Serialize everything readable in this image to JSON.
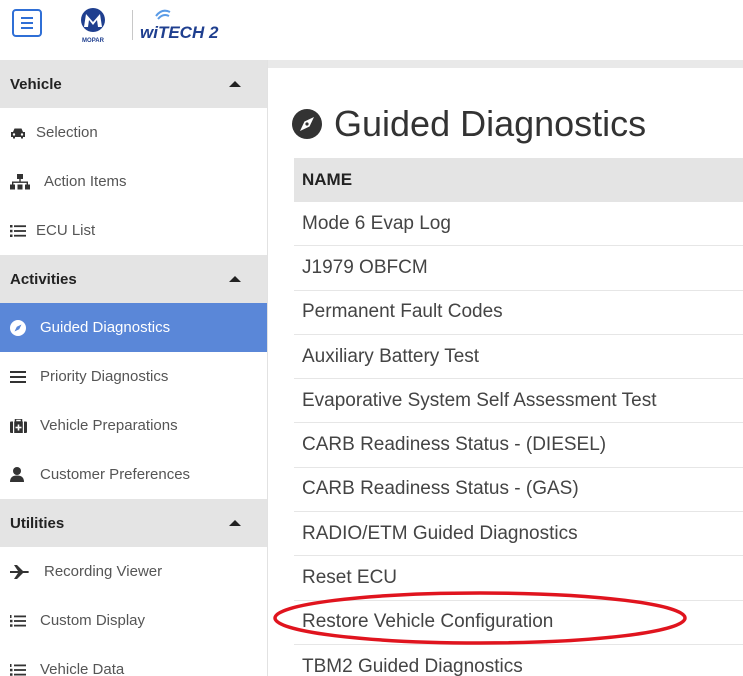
{
  "header": {
    "menu_icon": "hamburger-icon",
    "brand_logo": "MOPAR",
    "app_logo": "wiTECH 2"
  },
  "sidebar": {
    "sections": [
      {
        "label": "Vehicle",
        "items": [
          {
            "label": "Selection",
            "icon": "car-icon"
          },
          {
            "label": "Action Items",
            "icon": "sitemap-icon"
          },
          {
            "label": "ECU List",
            "icon": "list-icon"
          }
        ]
      },
      {
        "label": "Activities",
        "items": [
          {
            "label": "Guided Diagnostics",
            "icon": "compass-icon",
            "active": true
          },
          {
            "label": "Priority Diagnostics",
            "icon": "bars-icon"
          },
          {
            "label": "Vehicle Preparations",
            "icon": "medkit-icon"
          },
          {
            "label": "Customer Preferences",
            "icon": "user-icon"
          }
        ]
      },
      {
        "label": "Utilities",
        "items": [
          {
            "label": "Recording Viewer",
            "icon": "plane-icon"
          },
          {
            "label": "Custom Display",
            "icon": "numbered-list-icon"
          },
          {
            "label": "Vehicle Data",
            "icon": "numbered-list-icon"
          }
        ]
      }
    ]
  },
  "main": {
    "title": "Guided Diagnostics",
    "title_icon": "compass-icon",
    "table": {
      "column_header": "NAME",
      "rows": [
        "Mode 6 Evap Log",
        "J1979 OBFCM",
        "Permanent Fault Codes",
        "Auxiliary Battery Test",
        "Evaporative System Self Assessment Test",
        "CARB Readiness Status - (DIESEL)",
        "CARB Readiness Status - (GAS)",
        "RADIO/ETM Guided Diagnostics",
        "Reset ECU",
        "Restore Vehicle Configuration",
        "TBM2 Guided Diagnostics"
      ]
    }
  },
  "colors": {
    "accent": "#2f6fd6",
    "active_item": "#5a87d8",
    "section_header": "#e4e4e4",
    "annotation": "#e0141e"
  }
}
